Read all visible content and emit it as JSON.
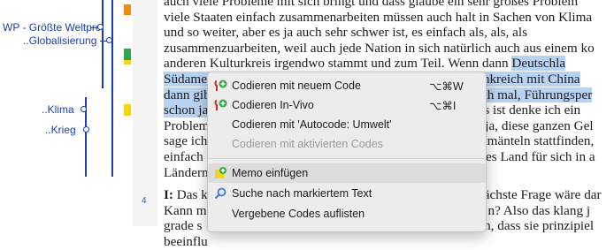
{
  "codes": {
    "globalisierung_parent": "WP - Größte Weltprc",
    "globalisierung": "..Globalisierung",
    "klima": "..Klima",
    "krieg": "..Krieg"
  },
  "colors": {
    "code_line": "#1a3fb0",
    "highlight": "#b8d2f2",
    "marker_yellow": "#f4d419",
    "marker_green": "#2ca84a",
    "marker_orange": "#f08a10"
  },
  "document": {
    "paragraph_number": "4",
    "lines": [
      "auch viele Probleme mit sich bringt und dass glaube ein sehr großes Problem",
      "viele Staaten einfach zusammenarbeiten müssen auch halt in Sachen von Klima",
      "und so weiter, aber es ja auch sehr schwer ist, es einfach als, als, als",
      "zusammenzuarbeiten, weil auch jede Nation in sich natürlich auch aus einem ko",
      "anderen Kulturkreis irgendwo stammt und zum Teil. Wenn dann "
    ],
    "line5_selected": "Deutschla",
    "line6_selected": "Südamerika kommunizieren muss, oder, keine Ahnung, Frankreich mit China",
    "line7_pre": "dann gib",
    "line7_mid": "t ich mal, ",
    "line7_selected_end": "Führungsper",
    "line8_pre": "schon ja",
    "line8_post": " das ist denke ich ein",
    "line9_pre": "Problem",
    "line9_post": " ja, diese ganzen Gel",
    "line10_pre": "sage ich",
    "line10_post": "ckmänteln stattfinden,",
    "line11_pre": "einfach",
    "line11_post": "edes Land für sich in a",
    "line12": "Ländern",
    "para_line1_label": "I:",
    "para_line1_pre": " Das k",
    "para_line1_post": "ächste Frage wäre dar",
    "para_line2_pre": "Kann m",
    "para_line2_post": "n? Also das klang j",
    "para_line3_pre": "grade s",
    "para_line3_post": "sen, dass sie prinzipiel",
    "para_line4": "beeinflu"
  },
  "context_menu": {
    "items": [
      {
        "label": "Codieren mit neuem Code",
        "shortcut": "⌥⌘W",
        "icon": "code-new-icon",
        "enabled": true
      },
      {
        "label": "Codieren In-Vivo",
        "shortcut": "⌥⌘I",
        "icon": "code-invivo-icon",
        "enabled": true
      },
      {
        "label": "Codieren mit 'Autocode: Umwelt'",
        "enabled": true
      },
      {
        "label": "Codieren mit aktivierten Codes",
        "enabled": false
      },
      {
        "label": "Memo einfügen",
        "icon": "memo-add-icon",
        "enabled": true
      },
      {
        "label": "Suche nach markiertem Text",
        "icon": "magnifier-icon",
        "enabled": true
      },
      {
        "label": "Vergebene Codes auflisten",
        "enabled": true
      }
    ]
  }
}
